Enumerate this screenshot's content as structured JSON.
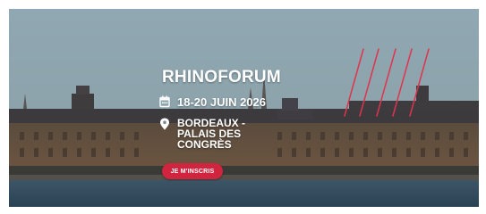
{
  "hero": {
    "title": "RHINOFORUM",
    "date": "18-20 JUIN 2026",
    "location_line1": "BORDEAUX -",
    "location_line2": "PALAIS DES",
    "location_line3": "CONGRÈS",
    "cta_label": "JE M'INSCRIS"
  },
  "colors": {
    "accent": "#d0243f",
    "sky": "#8fa6b1",
    "water": "#2f4a5c"
  },
  "icons": {
    "date_icon": "calendar-icon",
    "location_icon": "map-pin-icon"
  }
}
